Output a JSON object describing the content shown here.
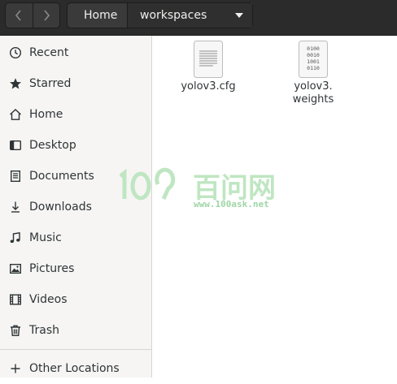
{
  "header": {
    "breadcrumb": [
      "Home",
      "workspaces"
    ]
  },
  "sidebar": {
    "items": [
      {
        "label": "Recent",
        "icon": "clock-icon"
      },
      {
        "label": "Starred",
        "icon": "star-icon"
      },
      {
        "label": "Home",
        "icon": "home-icon"
      },
      {
        "label": "Desktop",
        "icon": "desktop-icon"
      },
      {
        "label": "Documents",
        "icon": "documents-icon"
      },
      {
        "label": "Downloads",
        "icon": "download-icon"
      },
      {
        "label": "Music",
        "icon": "music-icon"
      },
      {
        "label": "Pictures",
        "icon": "pictures-icon"
      },
      {
        "label": "Videos",
        "icon": "videos-icon"
      },
      {
        "label": "Trash",
        "icon": "trash-icon"
      }
    ],
    "other_locations": "Other Locations"
  },
  "files": [
    {
      "name": "yolov3.cfg",
      "icon": "text-file-icon"
    },
    {
      "name_line1": "yolov3.",
      "name_line2": "weights",
      "icon": "binary-file-icon"
    }
  ],
  "watermark": {
    "logo_text": "100 百问网",
    "url": "www.100ask.net"
  }
}
